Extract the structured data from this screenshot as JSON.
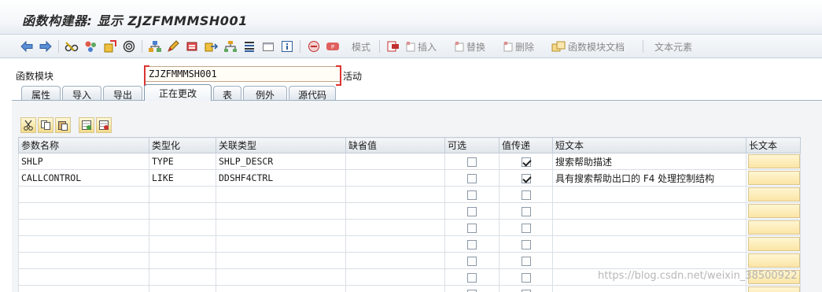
{
  "window": {
    "title": "函数构建器: 显示 ZJZFMMMSH001"
  },
  "toolbar": {
    "icons": [
      "back-arrow-icon",
      "forward-arrow-icon",
      "glasses-icon",
      "objects-icon",
      "where-used-icon",
      "target-icon",
      "hierarchy-icon",
      "pencil-icon",
      "display-object-icon",
      "export-icon",
      "tree-icon",
      "stack-icon",
      "window-icon",
      "info-icon",
      "pattern-icon",
      "pattern2-icon",
      "insert-row-icon",
      "insert-icon",
      "replace-icon",
      "delete-icon",
      "doc-icon"
    ],
    "mode_label": "模式",
    "insert_label": "插入",
    "replace_label": "替换",
    "delete_label": "删除",
    "doc_label": "函数模块文档",
    "text_elements_label": "文本元素"
  },
  "header": {
    "field_label": "函数模块",
    "field_value": "ZJZFMMMSH001",
    "status": "活动"
  },
  "tabs": [
    "属性",
    "导入",
    "导出",
    "正在更改",
    "表",
    "例外",
    "源代码"
  ],
  "active_tab": "正在更改",
  "table": {
    "columns": [
      "参数名称",
      "类型化",
      "关联类型",
      "缺省值",
      "可选",
      "值传递",
      "短文本",
      "长文本"
    ],
    "rows": [
      {
        "name": "SHLP",
        "typing": "TYPE",
        "ref_type": "SHLP_DESCR",
        "default": "",
        "optional": false,
        "by_value": true,
        "short_text": "搜索帮助描述"
      },
      {
        "name": "CALLCONTROL",
        "typing": "LIKE",
        "ref_type": "DDSHF4CTRL",
        "default": "",
        "optional": false,
        "by_value": true,
        "short_text": "具有搜索帮助出口的 F4 处理控制结构"
      },
      {
        "name": "",
        "typing": "",
        "ref_type": "",
        "default": "",
        "optional": false,
        "by_value": false,
        "short_text": ""
      },
      {
        "name": "",
        "typing": "",
        "ref_type": "",
        "default": "",
        "optional": false,
        "by_value": false,
        "short_text": ""
      },
      {
        "name": "",
        "typing": "",
        "ref_type": "",
        "default": "",
        "optional": false,
        "by_value": false,
        "short_text": ""
      },
      {
        "name": "",
        "typing": "",
        "ref_type": "",
        "default": "",
        "optional": false,
        "by_value": false,
        "short_text": ""
      },
      {
        "name": "",
        "typing": "",
        "ref_type": "",
        "default": "",
        "optional": false,
        "by_value": false,
        "short_text": ""
      },
      {
        "name": "",
        "typing": "",
        "ref_type": "",
        "default": "",
        "optional": false,
        "by_value": false,
        "short_text": ""
      },
      {
        "name": "",
        "typing": "",
        "ref_type": "",
        "default": "",
        "optional": false,
        "by_value": false,
        "short_text": ""
      }
    ]
  },
  "watermark": "https://blog.csdn.net/weixin_38500922",
  "colors": {
    "input_border": "#d33333",
    "longtext_button": "#fbe5a6",
    "header_bg": "#dfe5eb"
  }
}
